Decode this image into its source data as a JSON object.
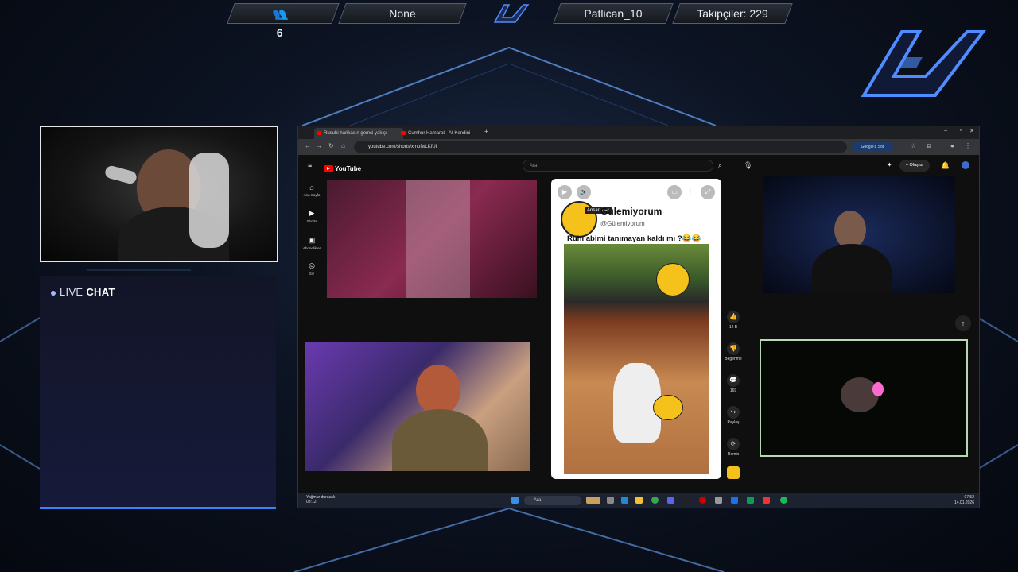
{
  "overlay": {
    "viewer_count": "6",
    "game": "None",
    "streamer": "Patlican_10",
    "followers": "Takipçiler: 229",
    "live_chat_word1": "LIVE",
    "live_chat_word2": "CHAT"
  },
  "browser": {
    "tabs": [
      {
        "label": "Rusuhi harikasın gemci yakışı"
      },
      {
        "label": "Cumhur Hamarat - At Kendini"
      }
    ],
    "url": "youtube.com/shorts/xmpfwLKfUI",
    "google_button": "Google'a Sor"
  },
  "youtube": {
    "logo_text": "YouTube",
    "search_placeholder": "Ara",
    "create_label": "Oluştur",
    "sidebar": [
      {
        "icon": "home-icon",
        "label": "Ana Sayfa"
      },
      {
        "icon": "shorts-icon",
        "label": "Shorts"
      },
      {
        "icon": "subscriptions-icon",
        "label": "Abonelikler"
      },
      {
        "icon": "you-icon",
        "label": "Siz"
      }
    ],
    "short": {
      "channel_name": "Gülemiyorum",
      "channel_handle": "@Gülemiyorum",
      "caption": "Ruhi abimi tanımayan kaldı mı ?😂😂",
      "tooltip": "Ansarı bak"
    },
    "actions": [
      {
        "icon": "like-icon",
        "label": "12 B"
      },
      {
        "icon": "dislike-icon",
        "label": "Beğenme"
      },
      {
        "icon": "comment-icon",
        "label": "169"
      },
      {
        "icon": "share-icon",
        "label": "Paylaş"
      },
      {
        "icon": "remix-icon",
        "label": "Remix"
      }
    ]
  },
  "taskbar": {
    "weather": "Yağmur duracak",
    "weather_time": "08:12",
    "search": "Ara",
    "time": "07:52",
    "date": "14.01.2026"
  },
  "colors": {
    "accent_blue": "#3b82f6",
    "yt_red": "#ff0000"
  }
}
